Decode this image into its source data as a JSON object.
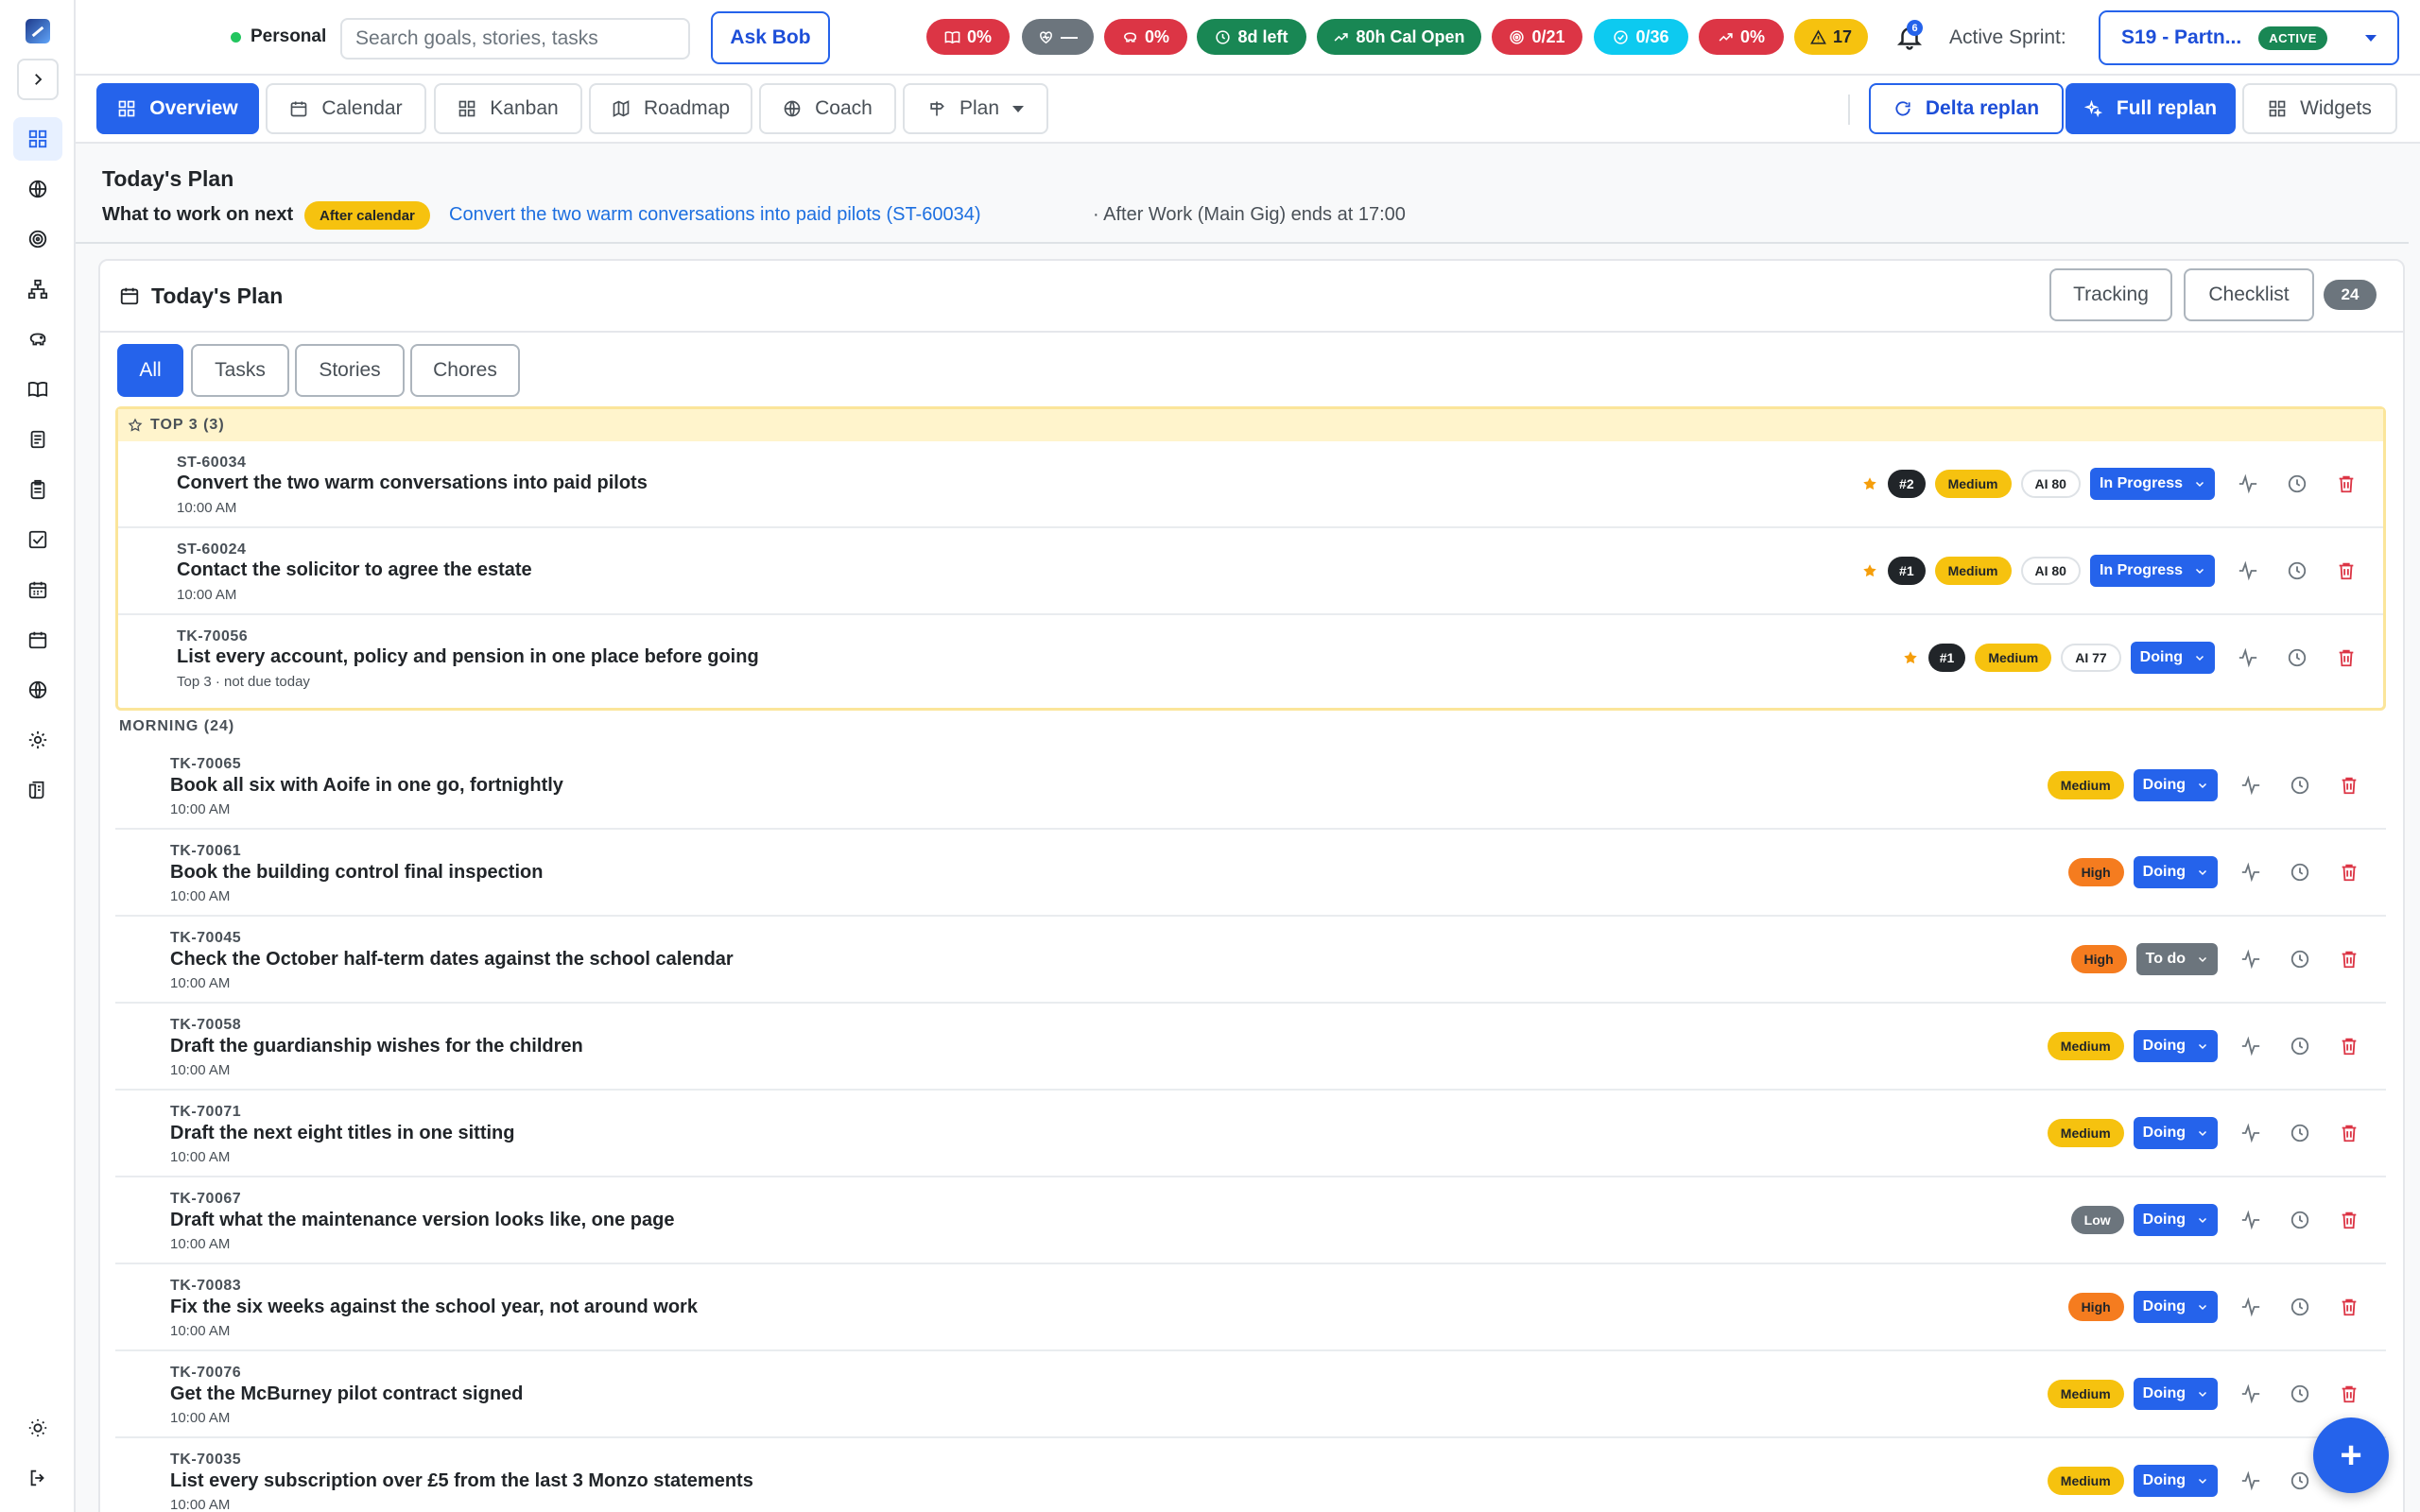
{
  "topbar": {
    "context": "Personal",
    "search_placeholder": "Search goals, stories, tasks",
    "ask_bob": "Ask Bob",
    "metrics": [
      {
        "label": "0%",
        "icon": "book-icon",
        "color": "#dc3545"
      },
      {
        "label": "—",
        "icon": "heart-pulse-icon",
        "color": "#6c757d"
      },
      {
        "label": "0%",
        "icon": "piggy-bank-icon",
        "color": "#dc3545"
      },
      {
        "label": "8d left",
        "icon": "clock-icon",
        "color": "#198754"
      },
      {
        "label": "80h Cal Open",
        "icon": "trend-up-icon",
        "color": "#198754"
      },
      {
        "label": "0/21",
        "icon": "target-icon",
        "color": "#dc3545"
      },
      {
        "label": "0/36",
        "icon": "check-circle-icon",
        "color": "#0dcaf0"
      },
      {
        "label": "0%",
        "icon": "trend-up-icon",
        "color": "#dc3545"
      },
      {
        "label": "17",
        "icon": "warning-icon",
        "color": "#f6c20f"
      }
    ],
    "notification_count": "6",
    "sprint_label": "Active Sprint:",
    "sprint_name": "S19 - Partn...",
    "sprint_status": "ACTIVE"
  },
  "nav": {
    "tabs": [
      "Overview",
      "Calendar",
      "Kanban",
      "Roadmap",
      "Coach",
      "Plan"
    ],
    "delta_replan": "Delta replan",
    "full_replan": "Full replan",
    "widgets": "Widgets"
  },
  "plan_header": {
    "title": "Today's Plan",
    "next_label": "What to work on next",
    "next_badge": "After calendar",
    "next_link": "Convert the two warm conversations into paid pilots (ST-60034)",
    "next_suffix": "· After Work (Main Gig) ends at 17:00"
  },
  "card": {
    "title": "Today's Plan",
    "tracking": "Tracking",
    "checklist": "Checklist",
    "count": "24",
    "filters": [
      "All",
      "Tasks",
      "Stories",
      "Chores"
    ],
    "top3_label": "TOP 3 (3)",
    "morning_label": "MORNING (24)"
  },
  "top3": [
    {
      "id": "ST-60034",
      "title": "Convert the two warm conversations into paid pilots",
      "time": "10:00 AM",
      "rank": "#2",
      "priority": "Medium",
      "ai": "AI 80",
      "status": "In Progress"
    },
    {
      "id": "ST-60024",
      "title": "Contact the solicitor to agree the estate",
      "time": "10:00 AM",
      "rank": "#1",
      "priority": "Medium",
      "ai": "AI 80",
      "status": "In Progress"
    },
    {
      "id": "TK-70056",
      "title": "List every account, policy and pension in one place before going",
      "time": "Top 3 · not due today",
      "rank": "#1",
      "priority": "Medium",
      "ai": "AI 77",
      "status": "Doing"
    }
  ],
  "morning": [
    {
      "id": "TK-70065",
      "title": "Book all six with Aoife in one go, fortnightly",
      "time": "10:00 AM",
      "priority": "Medium",
      "status": "Doing"
    },
    {
      "id": "TK-70061",
      "title": "Book the building control final inspection",
      "time": "10:00 AM",
      "priority": "High",
      "status": "Doing"
    },
    {
      "id": "TK-70045",
      "title": "Check the October half-term dates against the school calendar",
      "time": "10:00 AM",
      "priority": "High",
      "status": "To do"
    },
    {
      "id": "TK-70058",
      "title": "Draft the guardianship wishes for the children",
      "time": "10:00 AM",
      "priority": "Medium",
      "status": "Doing"
    },
    {
      "id": "TK-70071",
      "title": "Draft the next eight titles in one sitting",
      "time": "10:00 AM",
      "priority": "Medium",
      "status": "Doing"
    },
    {
      "id": "TK-70067",
      "title": "Draft what the maintenance version looks like, one page",
      "time": "10:00 AM",
      "priority": "Low",
      "status": "Doing"
    },
    {
      "id": "TK-70083",
      "title": "Fix the six weeks against the school year, not around work",
      "time": "10:00 AM",
      "priority": "High",
      "status": "Doing"
    },
    {
      "id": "TK-70076",
      "title": "Get the McBurney pilot contract signed",
      "time": "10:00 AM",
      "priority": "Medium",
      "status": "Doing"
    },
    {
      "id": "TK-70035",
      "title": "List every subscription over £5 from the last 3 Monzo statements",
      "time": "10:00 AM",
      "priority": "Medium",
      "status": "Doing"
    }
  ],
  "fab_label": "+"
}
